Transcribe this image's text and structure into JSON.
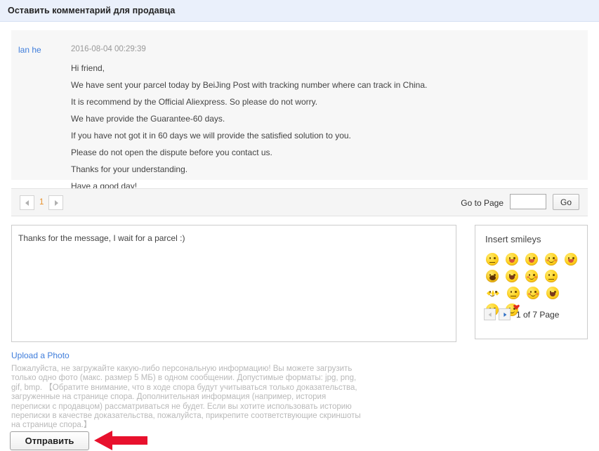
{
  "header": {
    "title": "Оставить комментарий для продавца"
  },
  "message": {
    "author": "lan he",
    "timestamp": "2016-08-04 00:29:39",
    "lines": [
      "Hi friend,",
      "We have sent your parcel today by BeiJing Post with tracking number where can track in China.",
      "It is recommend by the Official Aliexpress. So please do not worry.",
      "We have provide the Guarantee-60 days.",
      "If you have not got it in 60 days we will provide the satisfied solution to you.",
      "Please do not open the dispute before you contact us.",
      "Thanks for your understanding.",
      "Have a good day!"
    ]
  },
  "pagination": {
    "prev_icon": "triangle-left-icon",
    "next_icon": "triangle-right-icon",
    "current_page": "1",
    "goto_label": "Go to Page",
    "goto_value": "",
    "goto_placeholder": "",
    "go_button": "Go",
    "current_page_color": "#e8912a"
  },
  "reply": {
    "value": "Thanks for the message, I wait for a parcel :)",
    "placeholder": ""
  },
  "smileys": {
    "title": "Insert smileys",
    "items": [
      {
        "name": "smiley-neutral",
        "class": "s-flat"
      },
      {
        "name": "smiley-wink-tongue",
        "class": "s-tongue"
      },
      {
        "name": "smiley-tongue-out",
        "class": "s-tongue"
      },
      {
        "name": "smiley-giggle",
        "class": "s-blush"
      },
      {
        "name": "smiley-drool",
        "class": "s-tongue"
      },
      {
        "name": "smiley-coffee-cup",
        "class": "s-coffee"
      },
      {
        "name": "smiley-laugh-cry",
        "class": "s-open"
      },
      {
        "name": "smiley-shy-blush",
        "class": "s-blush"
      },
      {
        "name": "smiley-covering-face",
        "class": "s-flat"
      },
      {
        "name": "smiley-starburst",
        "class": "s-burst"
      },
      {
        "name": "smiley-smug",
        "class": "s-flat"
      },
      {
        "name": "smiley-pleased",
        "class": "s-blush"
      },
      {
        "name": "smiley-victory",
        "class": "s-open"
      },
      {
        "name": "smiley-surprised-o",
        "class": "s-open"
      },
      {
        "name": "smiley-kiss-heart",
        "class": "s-kiss"
      }
    ],
    "pager": {
      "prev_icon": "triangle-left-icon",
      "next_icon": "triangle-right-icon",
      "page_text": "1 of 7 Page"
    }
  },
  "upload": {
    "link_label": "Upload a Photo",
    "disclaimer": "Пожалуйста, не загружайте какую-либо персональную информацию! Вы можете загрузить только одно фото (макс. размер 5 МБ) в одном сообщении. Допустимые форматы: jpg, png, gif, bmp. 【Обратите внимание, что в ходе спора будут учитываться только доказательства, загруженные на странице спора. Дополнительная информация (например, история переписки с продавцом) рассматриваться не будет. Если вы хотите использовать историю переписки в качестве доказательства, пожалуйста, прикрепите соответствующие скриншоты на странице спора.】"
  },
  "submit": {
    "label": "Отправить"
  },
  "annotation": {
    "arrow_icon": "arrow-left-icon",
    "arrow_color": "#E8112D"
  }
}
